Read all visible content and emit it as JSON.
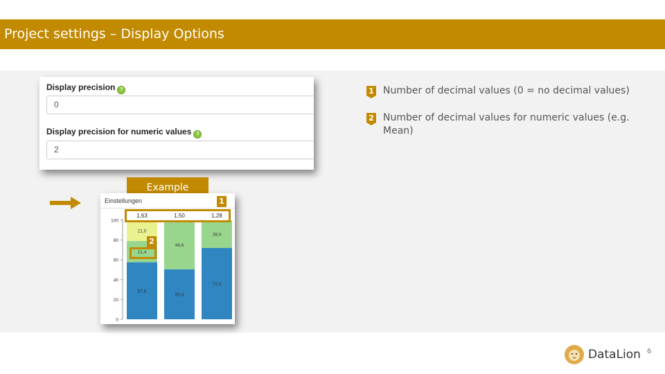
{
  "slide": {
    "title": "Project settings – Display Options",
    "page_number": "6",
    "logo_text": "DataLion"
  },
  "settings": {
    "field1_label": "Display precision",
    "field1_value": "0",
    "field2_label": "Display precision for numeric values",
    "field2_value": "2"
  },
  "example_label": "Example",
  "chart_card": {
    "header": "Einstellungen",
    "badge1": "1",
    "badge2": "2"
  },
  "info": [
    {
      "num": "1",
      "text": "Number of decimal values (0 = no decimal values)"
    },
    {
      "num": "2",
      "text": "Number of decimal values for numeric values (e.g. Mean)"
    }
  ],
  "chart_data": {
    "type": "bar",
    "stacked": true,
    "categories": [
      "",
      "",
      ""
    ],
    "top_labels": [
      "1,63",
      "1,50",
      "1,28"
    ],
    "ylim": [
      0,
      100
    ],
    "yticks": [
      "0",
      "20",
      "40",
      "60",
      "80",
      "100"
    ],
    "series": [
      {
        "color": "#2f86c1",
        "values": [
          57.6,
          50.4,
          72.0
        ],
        "labels": [
          "57,6",
          "50,4",
          "72,0"
        ]
      },
      {
        "color": "#98d68e",
        "values": [
          21.4,
          49.6,
          28.0
        ],
        "labels": [
          "21,4",
          "49,6",
          "28,0"
        ]
      },
      {
        "color": "#e9f28f",
        "values": [
          21.0,
          0,
          0
        ],
        "labels": [
          "21,0",
          "",
          ""
        ]
      }
    ]
  }
}
